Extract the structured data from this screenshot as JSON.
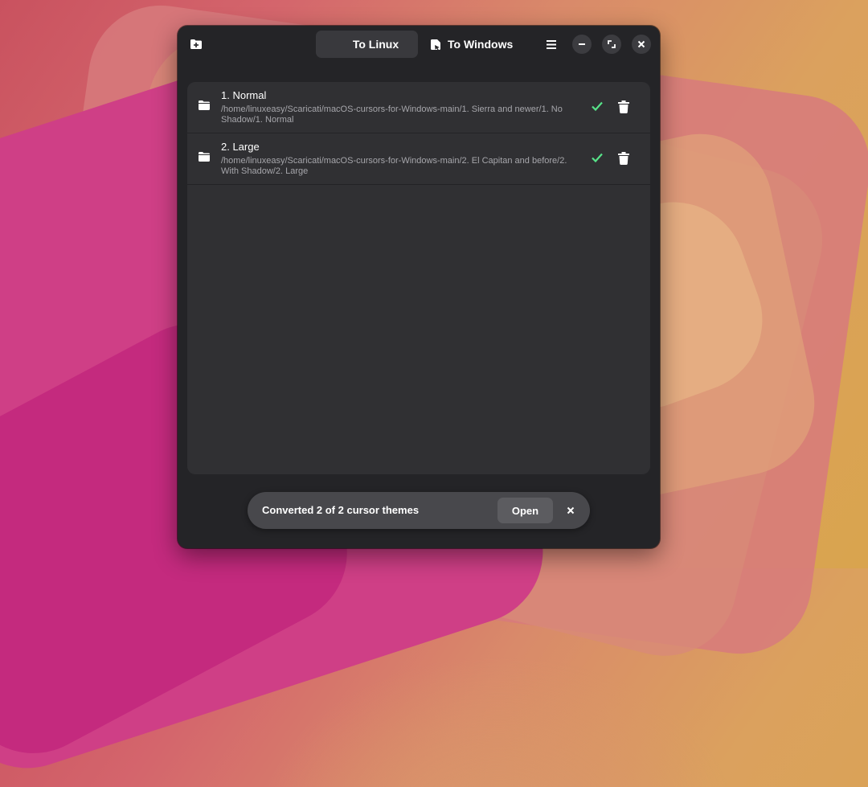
{
  "header": {
    "tabs": [
      {
        "label": "To Linux",
        "active": true
      },
      {
        "label": "To Windows",
        "active": false
      }
    ],
    "icons": {
      "add": "folder-add-icon",
      "menu": "hamburger-menu-icon",
      "minimize": "minimize-icon",
      "maximize": "maximize-icon",
      "close": "close-icon"
    }
  },
  "themes": [
    {
      "name": "1. Normal",
      "path": "/home/linuxeasy/Scaricati/macOS-cursors-for-Windows-main/1. Sierra and newer/1. No Shadow/1. Normal",
      "status": "done"
    },
    {
      "name": "2. Large",
      "path": "/home/linuxeasy/Scaricati/macOS-cursors-for-Windows-main/2. El Capitan and before/2. With Shadow/2. Large",
      "status": "done"
    }
  ],
  "toast": {
    "message": "Converted 2 of 2 cursor themes",
    "action_label": "Open"
  },
  "colors": {
    "window_bg": "#242427",
    "list_bg": "#303033",
    "success": "#57e389",
    "toast_bg": "#48484c"
  }
}
